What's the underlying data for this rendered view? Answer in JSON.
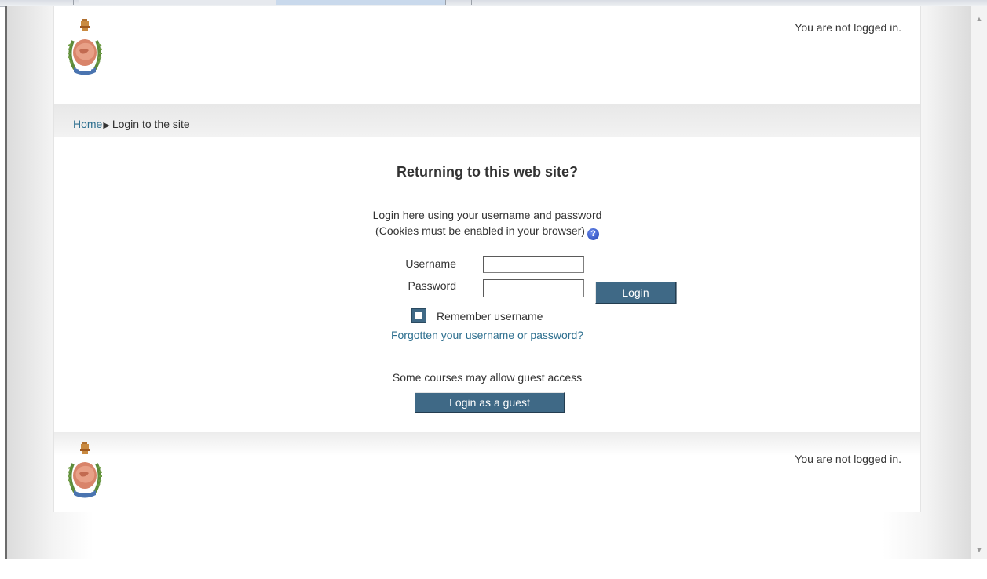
{
  "header": {
    "login_info": "You are not logged in."
  },
  "breadcrumb": {
    "home": "Home",
    "separator": "▶",
    "current": "Login to the site"
  },
  "login": {
    "heading": "Returning to this web site?",
    "description_line1": "Login here using your username and password",
    "description_line2": "(Cookies must be enabled in your browser)",
    "help_icon_glyph": "?",
    "username_label": "Username",
    "username_value": "",
    "password_label": "Password",
    "password_value": "",
    "login_button": "Login",
    "remember_label": "Remember username",
    "remember_checked": false,
    "forgot_link": "Forgotten your username or password?",
    "guest_note": "Some courses may allow guest access",
    "guest_button": "Login as a guest"
  },
  "footer": {
    "login_info": "You are not logged in."
  },
  "colors": {
    "button_bg": "#3f6986",
    "link": "#2d6f8f"
  },
  "icons": {
    "logo": "government-emblem-icon",
    "help": "help-icon"
  }
}
